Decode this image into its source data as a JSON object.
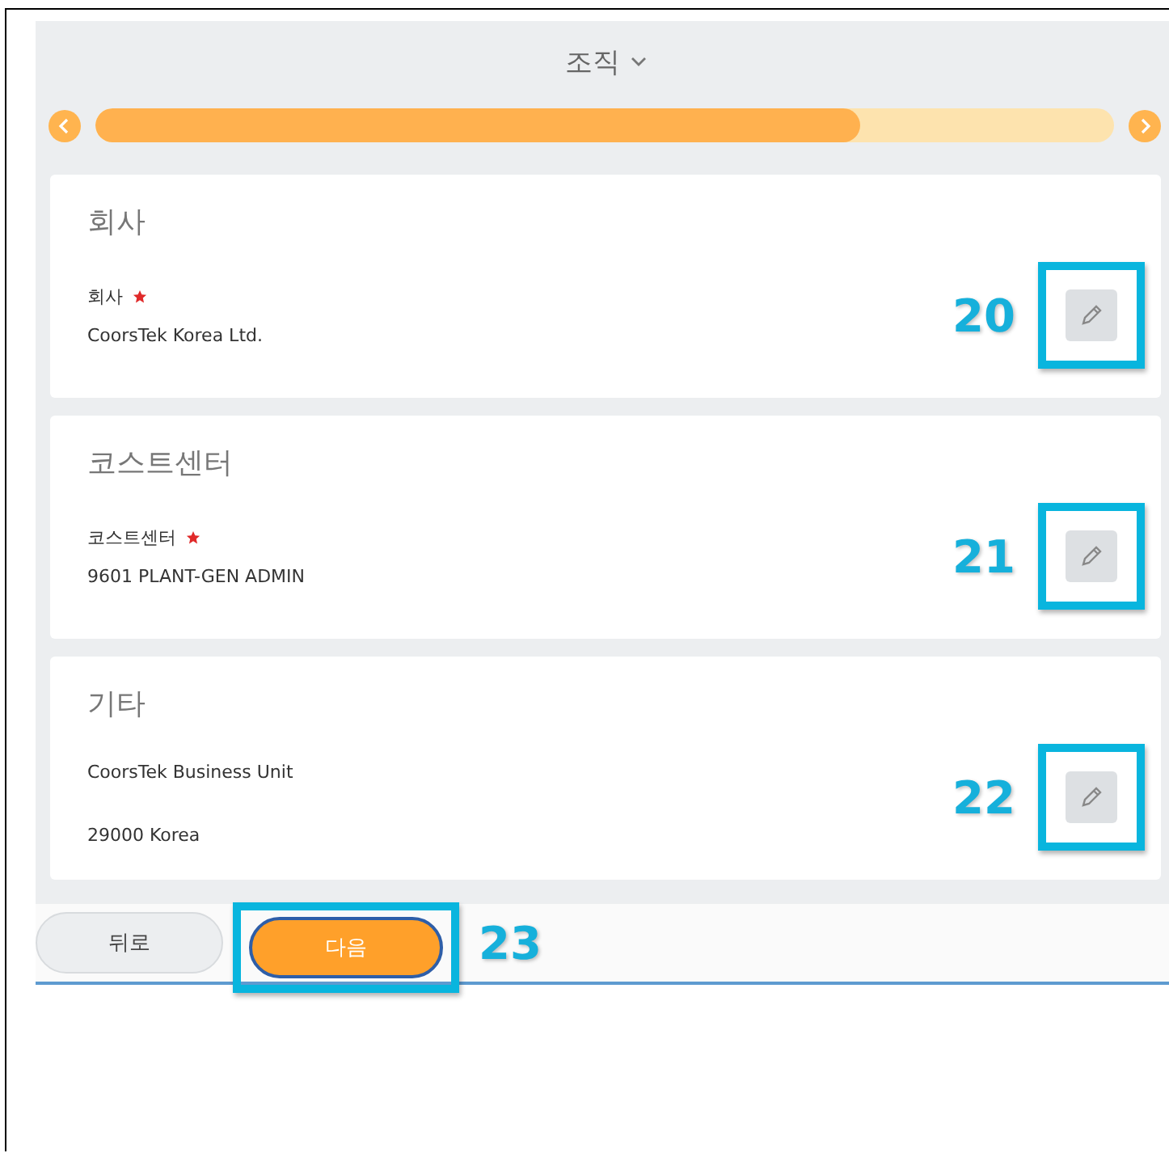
{
  "header": {
    "title": "조직",
    "progress": {
      "level": 0.75
    }
  },
  "cards": [
    {
      "title": "회사",
      "callout": "20",
      "lines": [
        {
          "kind": "label",
          "text": "회사",
          "required": true
        },
        {
          "kind": "value",
          "text": "CoorsTek Korea Ltd."
        }
      ]
    },
    {
      "title": "코스트센터",
      "callout": "21",
      "lines": [
        {
          "kind": "label",
          "text": "코스트센터",
          "required": true
        },
        {
          "kind": "value",
          "text": "9601 PLANT-GEN ADMIN"
        }
      ]
    },
    {
      "title": "기타",
      "callout": "22",
      "lines": [
        {
          "kind": "value",
          "text": "CoorsTek Business Unit"
        },
        {
          "kind": "value",
          "text": "29000 Korea"
        }
      ]
    }
  ],
  "footer": {
    "back": "뒤로",
    "next": "다음",
    "callout": "23"
  }
}
